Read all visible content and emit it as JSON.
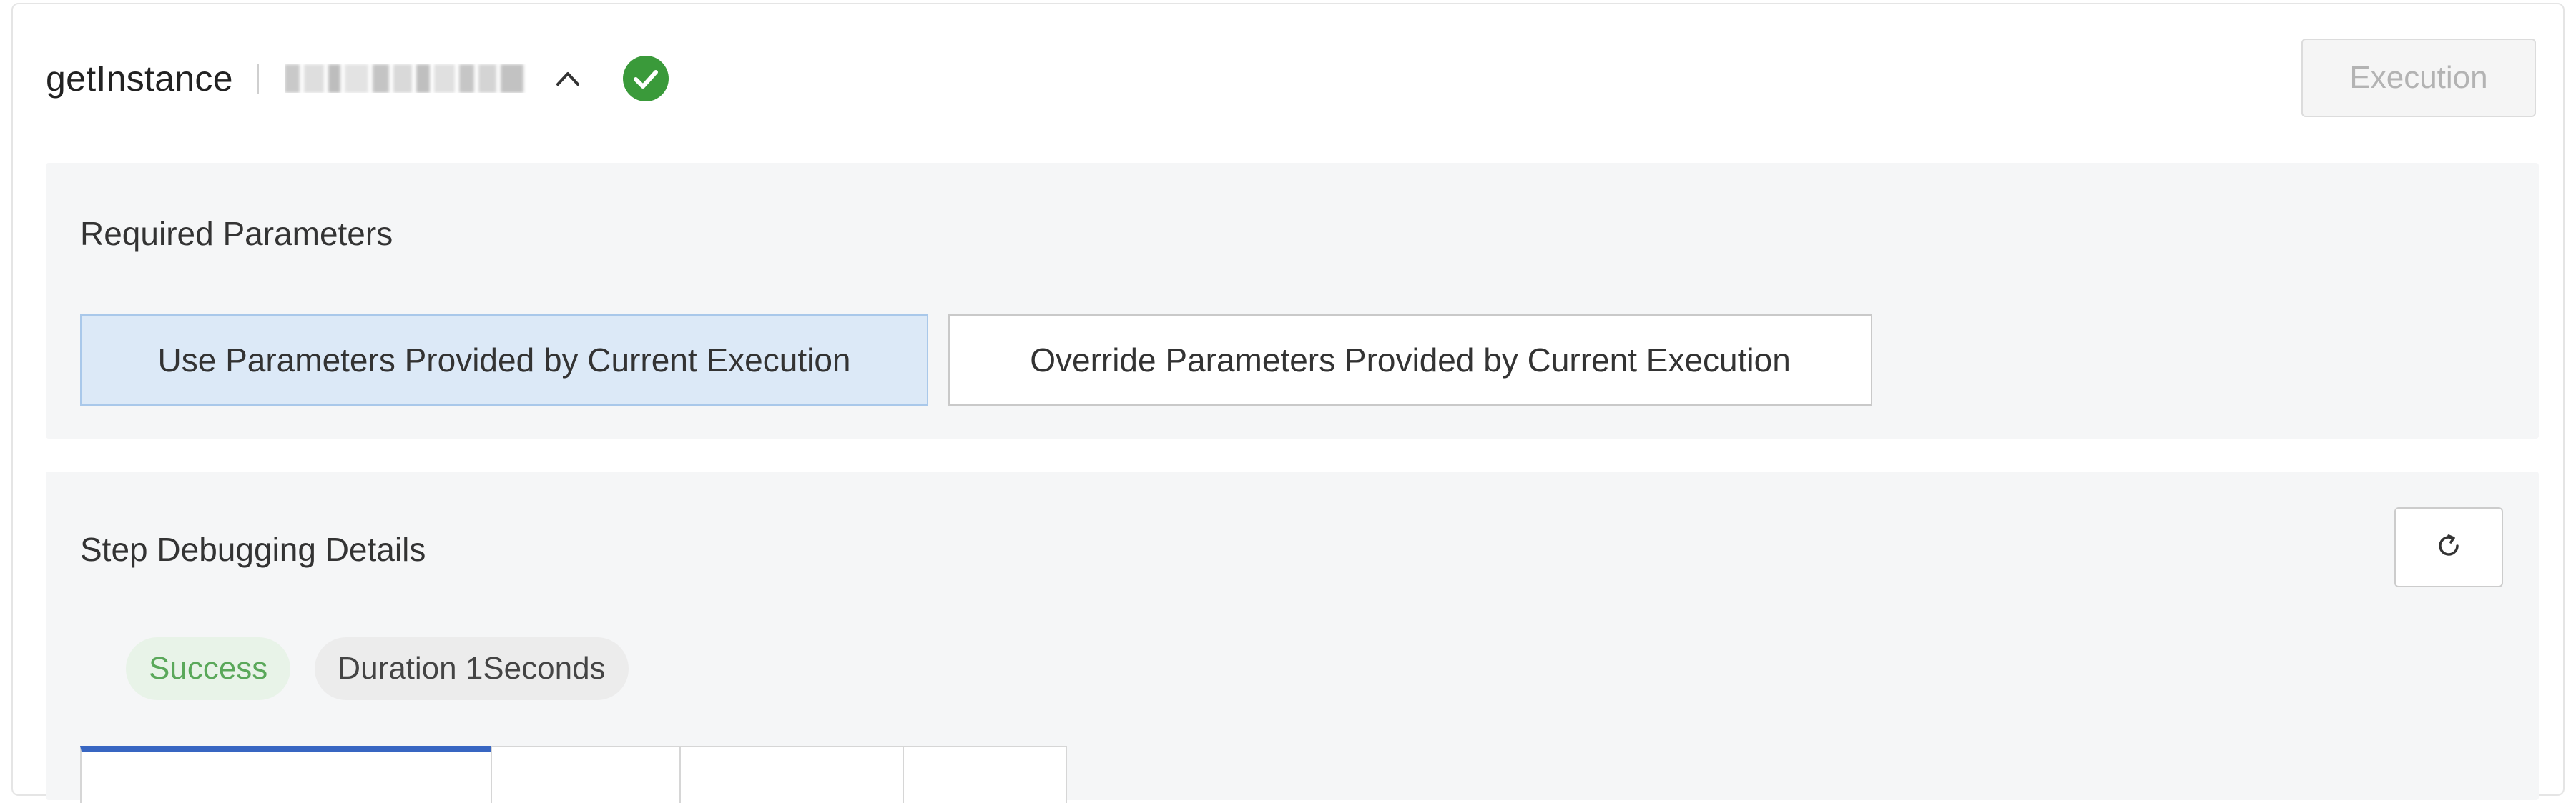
{
  "header": {
    "step_name": "getInstance",
    "collapse_icon": "chevron-up-icon",
    "status_icon": "check-circle-icon",
    "status_color": "#3a9a3a",
    "execution_button_label": "Execution"
  },
  "required_parameters": {
    "title": "Required Parameters",
    "options": [
      {
        "label": "Use Parameters Provided by Current Execution",
        "selected": true
      },
      {
        "label": "Override Parameters Provided by Current Execution",
        "selected": false
      }
    ]
  },
  "step_debugging": {
    "title": "Step Debugging Details",
    "refresh_icon": "refresh-icon",
    "status_badge": "Success",
    "duration_badge": "Duration 1Seconds",
    "accent_color": "#3866c2"
  }
}
